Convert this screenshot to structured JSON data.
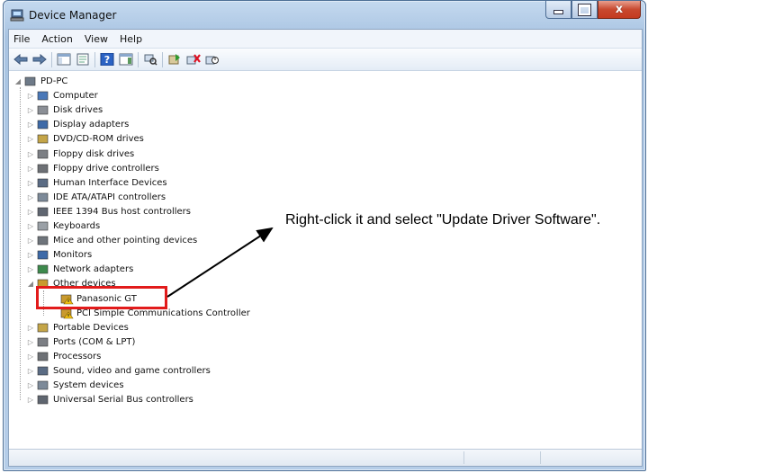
{
  "window": {
    "title": "Device Manager",
    "caption_buttons": {
      "minimize": "minimize",
      "maximize": "maximize",
      "close": "x"
    }
  },
  "menu": [
    "File",
    "Action",
    "View",
    "Help"
  ],
  "toolbar_icons": [
    "back-arrow-icon",
    "forward-arrow-icon",
    "show-hide-console-tree-icon",
    "properties-icon",
    "help-icon",
    "action-pane-icon",
    "scan-hardware-icon",
    "update-driver-icon",
    "uninstall-icon",
    "disable-icon"
  ],
  "tree": {
    "root": "PD-PC",
    "categories": [
      "Computer",
      "Disk drives",
      "Display adapters",
      "DVD/CD-ROM drives",
      "Floppy disk drives",
      "Floppy drive controllers",
      "Human Interface Devices",
      "IDE ATA/ATAPI controllers",
      "IEEE 1394 Bus host controllers",
      "Keyboards",
      "Mice and other pointing devices",
      "Monitors",
      "Network adapters",
      "Other devices"
    ],
    "other_devices": [
      "Panasonic GT",
      "PCI Simple Communications Controller"
    ],
    "categories_after": [
      "Portable Devices",
      "Ports (COM & LPT)",
      "Processors",
      "Sound, video and game controllers",
      "System devices",
      "Universal Serial Bus controllers"
    ]
  },
  "annotation": {
    "callout_text": "Right-click it and select \"Update Driver Software\".",
    "highlight_color": "#e21b1b"
  }
}
